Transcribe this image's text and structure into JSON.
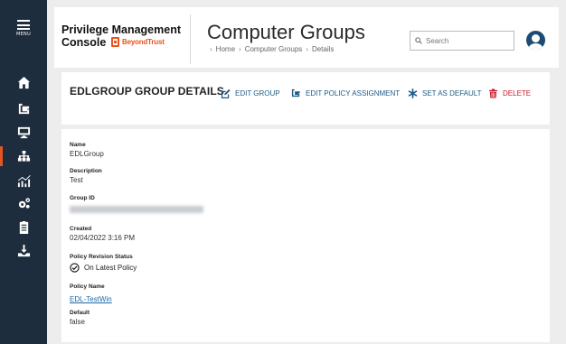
{
  "nav": {
    "menu_label": "MENU",
    "items": [
      {
        "id": "home",
        "icon": "home-icon"
      },
      {
        "id": "policy",
        "icon": "policy-icon"
      },
      {
        "id": "computers",
        "icon": "monitor-icon"
      },
      {
        "id": "computer-groups",
        "icon": "hierarchy-icon",
        "active": true
      },
      {
        "id": "analytics",
        "icon": "analytics-icon"
      },
      {
        "id": "configuration",
        "icon": "gears-icon"
      },
      {
        "id": "tasks",
        "icon": "clipboard-icon"
      },
      {
        "id": "download",
        "icon": "download-icon"
      }
    ]
  },
  "header": {
    "brand_line1": "Privilege Management",
    "brand_line2": "Console",
    "brand_logo_text": "BeyondTrust",
    "title": "Computer Groups",
    "breadcrumb": [
      "Home",
      "Computer Groups",
      "Details"
    ],
    "search_placeholder": "Search"
  },
  "toolbar": {
    "heading": "EDLGROUP GROUP DETAILS",
    "actions": {
      "edit_group": "EDIT GROUP",
      "edit_policy": "EDIT POLICY ASSIGNMENT",
      "set_default": "SET AS DEFAULT",
      "delete": "DELETE"
    }
  },
  "details": {
    "name_label": "Name",
    "name_value": "EDLGroup",
    "description_label": "Description",
    "description_value": "Test",
    "group_id_label": "Group ID",
    "created_label": "Created",
    "created_value": "02/04/2022 3:16 PM",
    "revision_label": "Policy Revision Status",
    "revision_value": "On Latest Policy",
    "policy_name_label": "Policy Name",
    "policy_name_value": "EDL-TestWin",
    "default_label": "Default",
    "default_value": "false"
  },
  "colors": {
    "rail_bg": "#1d2d3e",
    "accent": "#e8541f",
    "link": "#1d5a85",
    "danger": "#c6192b"
  }
}
